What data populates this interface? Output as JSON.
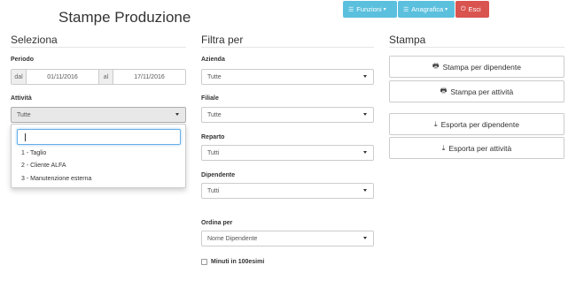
{
  "topbar": {
    "funzioni": "Funzioni",
    "anagrafica": "Anagrafica",
    "esci": "Esci"
  },
  "title": "Stampe Produzione",
  "seleziona": {
    "heading": "Seleziona",
    "periodo_label": "Periodo",
    "dal": "dal",
    "date_from": "01/11/2016",
    "al": "al",
    "date_to": "17/11/2016",
    "attivita_label": "Attività",
    "attivita_value": "Tutte",
    "dropdown_items": [
      "1 - Taglio",
      "2 - Cliente ALFA",
      "3 - Manutenzione esterna"
    ]
  },
  "filtra": {
    "heading": "Filtra per",
    "azienda_label": "Azienda",
    "azienda_value": "Tutte",
    "filiale_label": "Filiale",
    "filiale_value": "Tutte",
    "reparto_label": "Reparto",
    "reparto_value": "Tutti",
    "dipendente_label": "Dipendente",
    "dipendente_value": "Tutti",
    "ordina_label": "Ordina per",
    "ordina_value": "Nome Dipendente",
    "minuti_label": "Minuti in 100esimi"
  },
  "stampa": {
    "heading": "Stampa",
    "btn_stampa_dip": "Stampa per dipendente",
    "btn_stampa_att": "Stampa per attività",
    "btn_esporta_dip": "Esporta per dipendente",
    "btn_esporta_att": "Esporta per attività"
  },
  "colors": {
    "info": "#5bc0de",
    "danger": "#d9534f",
    "focus": "#66afe9"
  }
}
